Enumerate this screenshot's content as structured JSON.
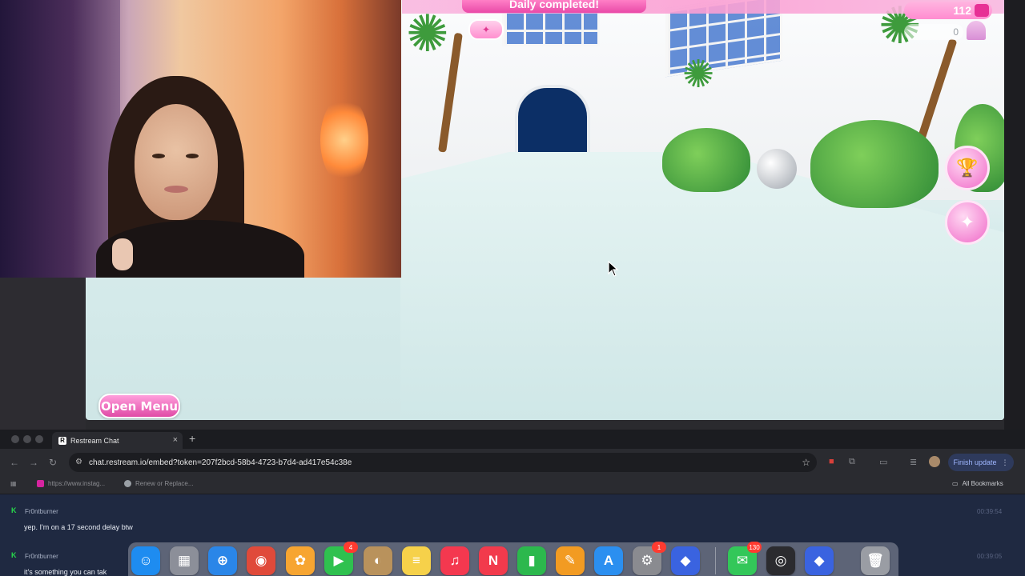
{
  "game": {
    "banner_text": "Daily completed!",
    "currency_value": "112",
    "secondary_value": "0",
    "open_menu_label": "Open Menu",
    "badge_icon": "sparkle-icon",
    "side_buttons": [
      {
        "name": "trophy-icon",
        "glyph": "🏆"
      },
      {
        "name": "pose-icon",
        "glyph": "✦"
      }
    ]
  },
  "browser": {
    "tab_title": "Restream Chat",
    "tab_favicon": "R",
    "new_tab_symbol": "+",
    "close_symbol": "×",
    "url": "chat.restream.io/embed?token=207f2bcd-58b4-4723-b7d4-ad417e54c38e",
    "finish_update_label": "Finish update",
    "bookmarks": [
      {
        "label": "https://www.instag...",
        "color": "#d6249f"
      },
      {
        "label": "Renew or Replace...",
        "color": "#9aa0a6"
      }
    ],
    "all_bookmarks_label": "All Bookmarks"
  },
  "chat": {
    "messages": [
      {
        "user": "Fr0ntburner",
        "text": "yep. I'm on a 17 second delay btw",
        "time": "00:39:54"
      },
      {
        "user": "Fr0ntburner",
        "text": "it's something you can tak",
        "time": "00:39:05"
      }
    ]
  },
  "dock": {
    "apps": [
      {
        "name": "finder-icon",
        "color": "#1e8cf0",
        "glyph": "☺"
      },
      {
        "name": "launchpad-icon",
        "color": "#8c8f99",
        "glyph": "▦"
      },
      {
        "name": "safari-icon",
        "color": "#2a86e8",
        "glyph": "⊕"
      },
      {
        "name": "chrome-icon",
        "color": "#e04a3a",
        "glyph": "◉"
      },
      {
        "name": "photos-icon",
        "color": "#f7a531",
        "glyph": "✿"
      },
      {
        "name": "facetime-icon",
        "color": "#2fc14f",
        "glyph": "▶",
        "badge": "4"
      },
      {
        "name": "contacts-icon",
        "color": "#b9925c",
        "glyph": "◐"
      },
      {
        "name": "notes-icon",
        "color": "#f6d14a",
        "glyph": "≡"
      },
      {
        "name": "music-icon",
        "color": "#f4384f",
        "glyph": "♫"
      },
      {
        "name": "news-icon",
        "color": "#f23a4c",
        "glyph": "N"
      },
      {
        "name": "numbers-icon",
        "color": "#2cb84d",
        "glyph": "▮"
      },
      {
        "name": "pages-icon",
        "color": "#f29b22",
        "glyph": "✎"
      },
      {
        "name": "app-store-icon",
        "color": "#2b8ff0",
        "glyph": "A"
      },
      {
        "name": "system-settings-icon",
        "color": "#8a8b90",
        "glyph": "⚙",
        "badge": "1"
      },
      {
        "name": "roblox-icon",
        "color": "#3a63e0",
        "glyph": "◆"
      },
      {
        "name": "messages-icon",
        "color": "#33c759",
        "glyph": "✉",
        "badge": "130"
      },
      {
        "name": "obs-icon",
        "color": "#2b2b2f",
        "glyph": "◎"
      },
      {
        "name": "roblox-studio-icon",
        "color": "#3a63e0",
        "glyph": "◆"
      },
      {
        "name": "trash-icon",
        "color": "#9a9da4",
        "glyph": "🗑"
      }
    ]
  }
}
